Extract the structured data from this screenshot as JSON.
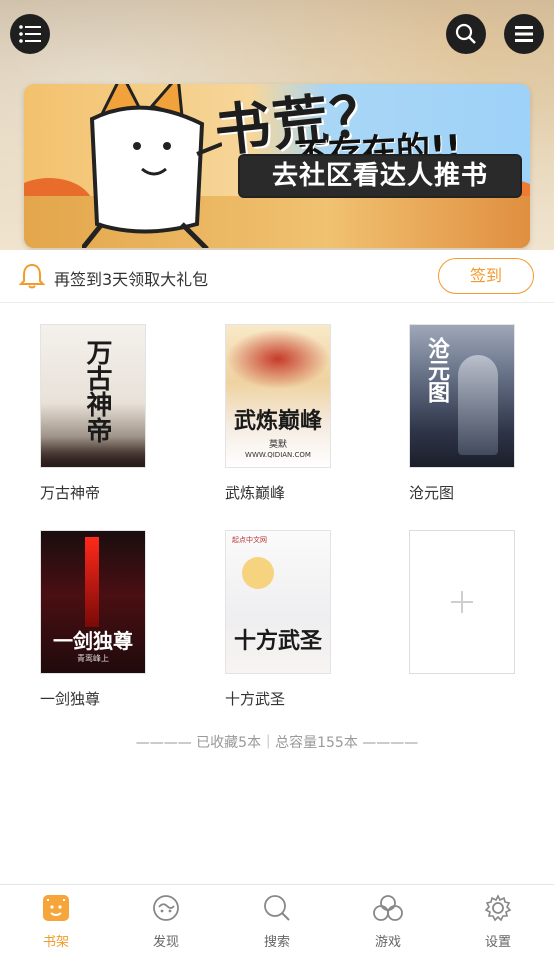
{
  "banner": {
    "headline": "书荒？",
    "subline": "不存在的!!",
    "cta": "去社区看达人推书"
  },
  "topbar": {
    "menu_icon": "menu-icon",
    "search_icon": "search-icon",
    "more_icon": "list-icon"
  },
  "signin": {
    "message": "再签到3天领取大礼包",
    "button_label": "签到"
  },
  "books": [
    {
      "title": "万古神帝",
      "cover_text": "万古神帝"
    },
    {
      "title": "武炼巅峰",
      "cover_text": "武炼巅峰",
      "cover_author": "莫默",
      "cover_site": "WWW.QIDIAN.COM"
    },
    {
      "title": "沧元图",
      "cover_text": "沧元图"
    },
    {
      "title": "一剑独尊",
      "cover_text": "一剑独尊",
      "cover_author": "青鸾峰上"
    },
    {
      "title": "十方武圣",
      "cover_text": "十方武圣",
      "cover_brand": "起点中文网"
    }
  ],
  "add_book": {
    "icon": "plus-icon"
  },
  "summary": "———— 已收藏5本｜总容量155本 ————",
  "tabs": [
    {
      "label": "书架",
      "icon": "bookshelf-icon",
      "active": true
    },
    {
      "label": "发现",
      "icon": "discover-icon",
      "active": false
    },
    {
      "label": "搜索",
      "icon": "search-icon",
      "active": false
    },
    {
      "label": "游戏",
      "icon": "game-icon",
      "active": false
    },
    {
      "label": "设置",
      "icon": "settings-icon",
      "active": false
    }
  ],
  "colors": {
    "accent": "#f39a2b",
    "text": "#333333",
    "muted": "#999999"
  }
}
